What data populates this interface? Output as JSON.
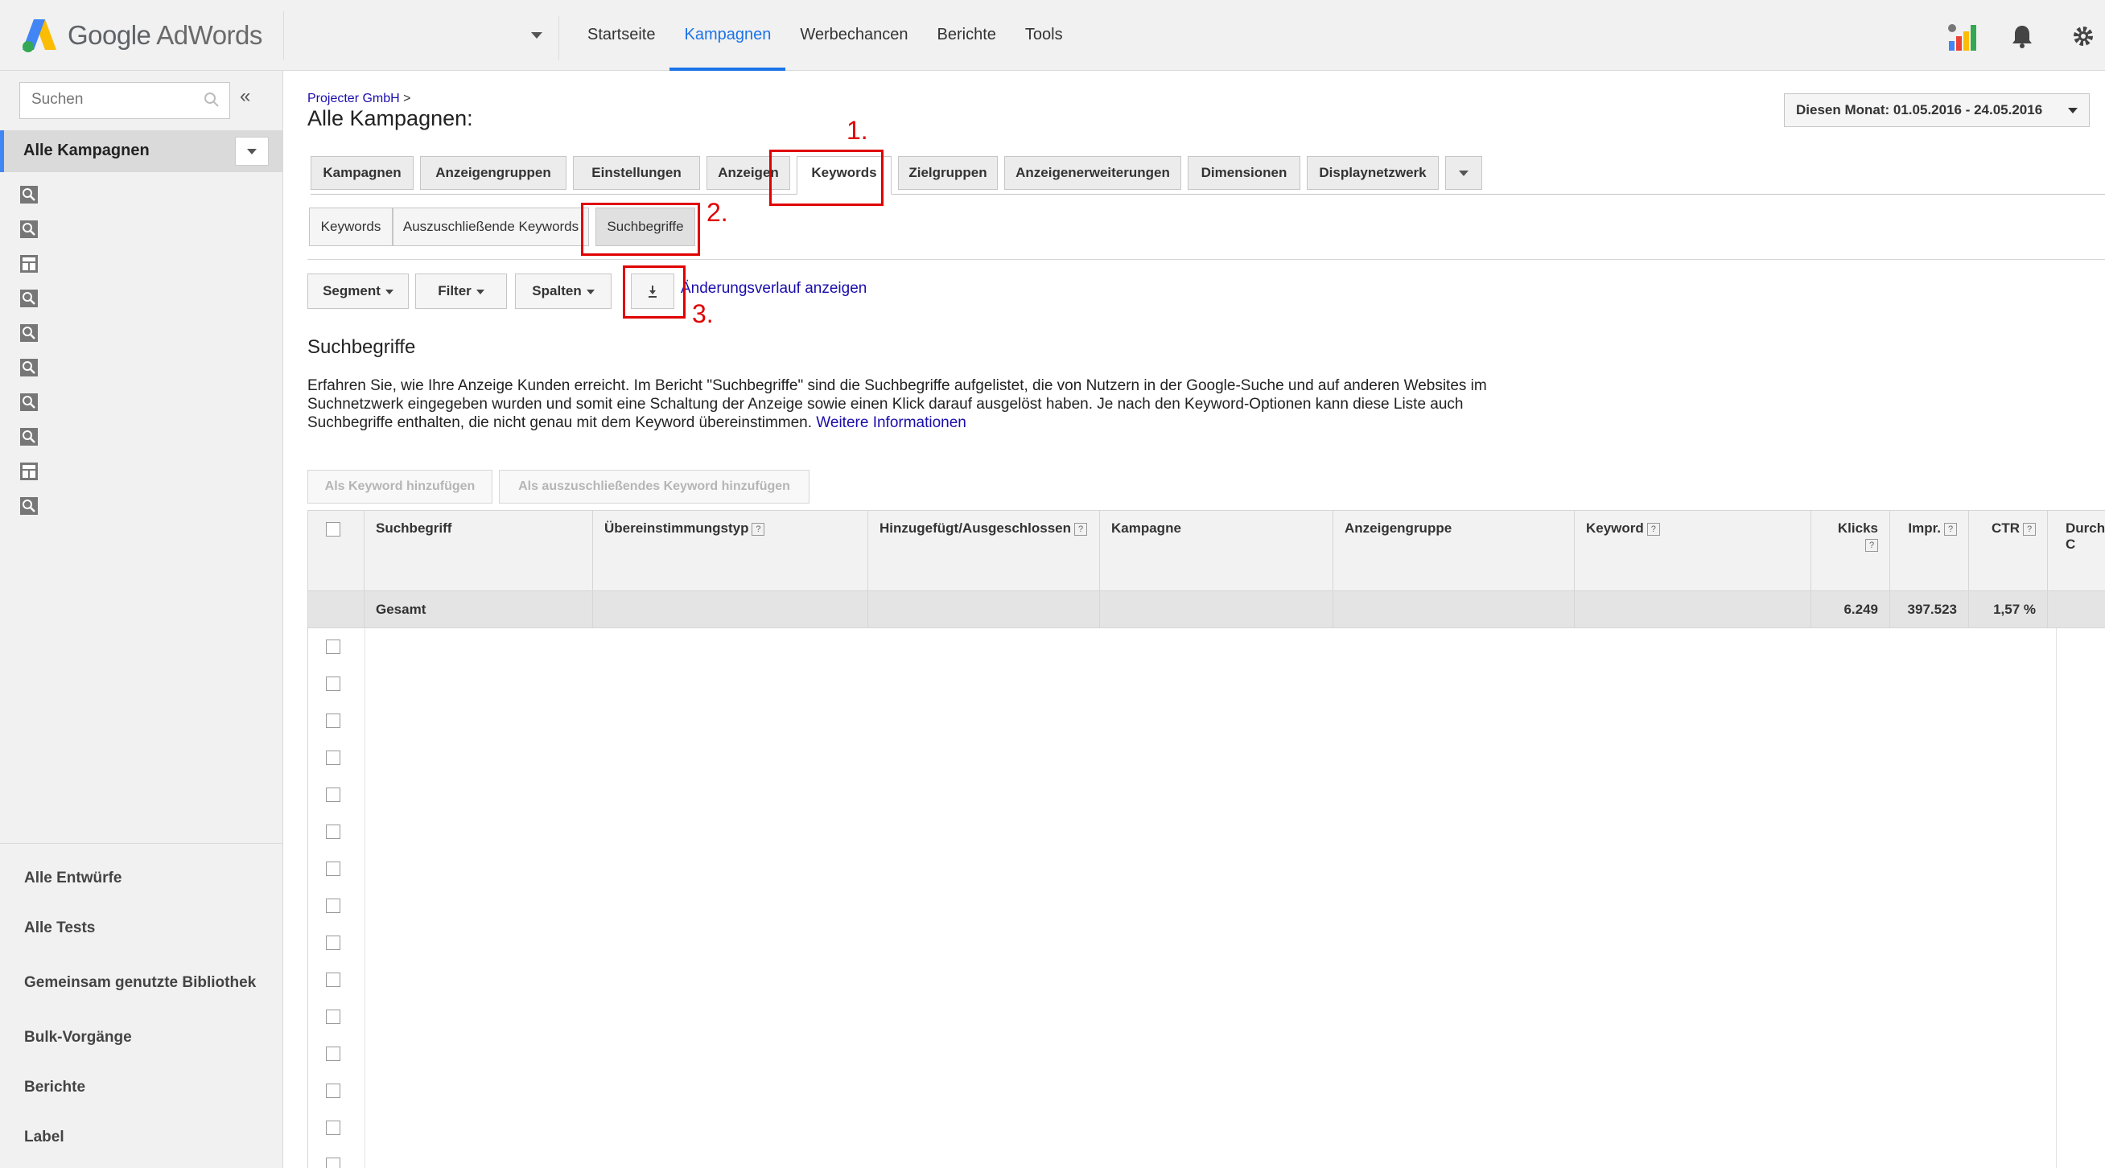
{
  "header": {
    "brand_google": "Google",
    "brand_product": "AdWords",
    "nav": [
      "Startseite",
      "Kampagnen",
      "Werbechancen",
      "Berichte",
      "Tools"
    ],
    "active_nav": "Kampagnen",
    "icons": [
      "account-performance-icon",
      "bell-icon",
      "gear-icon"
    ]
  },
  "sidebar": {
    "search_placeholder": "Suchen",
    "collapse_label": "«",
    "all_campaigns": "Alle Kampagnen",
    "campaign_icons": [
      "search-campaign-icon",
      "search-campaign-icon",
      "display-campaign-icon",
      "search-campaign-icon",
      "search-campaign-icon",
      "search-campaign-icon",
      "search-campaign-icon",
      "search-campaign-icon",
      "display-campaign-icon",
      "search-campaign-icon"
    ],
    "links": [
      "Alle Entwürfe",
      "Alle Tests",
      "Gemeinsam genutzte Bibliothek",
      "Bulk-Vorgänge",
      "Berichte",
      "Label"
    ]
  },
  "page": {
    "breadcrumb": "Projecter GmbH",
    "breadcrumb_sep": ">",
    "title": "Alle Kampagnen:",
    "date_range": "Diesen Monat: 01.05.2016 - 24.05.2016"
  },
  "tabs": [
    "Kampagnen",
    "Anzeigengruppen",
    "Einstellungen",
    "Anzeigen",
    "Keywords",
    "Zielgruppen",
    "Anzeigenerweiterungen",
    "Dimensionen",
    "Displaynetzwerk"
  ],
  "active_tab": "Keywords",
  "subtabs": [
    "Keywords",
    "Auszuschließende Keywords",
    "Suchbegriffe"
  ],
  "active_subtab": "Suchbegriffe",
  "toolbar": {
    "segment": "Segment",
    "filter": "Filter",
    "columns": "Spalten",
    "history_link": "Änderungsverlauf anzeigen"
  },
  "annotations": [
    "1.",
    "2.",
    "3."
  ],
  "section": {
    "title": "Suchbegriffe",
    "description": "Erfahren Sie, wie Ihre Anzeige Kunden erreicht. Im Bericht \"Suchbegriffe\" sind die Suchbegriffe aufgelistet, die von Nutzern in der Google-Suche und auf anderen Websites im Suchnetzwerk eingegeben wurden und somit eine Schaltung der Anzeige sowie einen Klick darauf ausgelöst haben. Je nach den Keyword-Optionen kann diese Liste auch Suchbegriffe enthalten, die nicht genau mit dem Keyword übereinstimmen.",
    "more_link": "Weitere Informationen"
  },
  "actions": {
    "add_keyword": "Als Keyword hinzufügen",
    "add_negative": "Als auszuschließendes Keyword hinzufügen"
  },
  "table": {
    "columns": [
      "Suchbegriff",
      "Übereinstimmungstyp",
      "Hinzugefügt/Ausgeschlossen",
      "Kampagne",
      "Anzeigengruppe",
      "Keyword",
      "Klicks",
      "Impr.",
      "CTR",
      "Durch C"
    ],
    "help_marker": "?",
    "total_label": "Gesamt",
    "total_clicks": "6.249",
    "total_impr": "397.523",
    "total_ctr": "1,57 %",
    "row_count": 15
  }
}
